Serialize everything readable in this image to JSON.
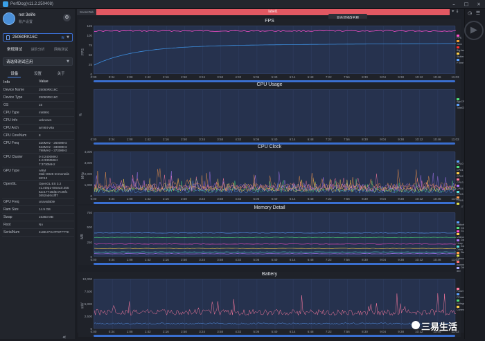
{
  "window": {
    "title": "PerfDog(v11.2.250408)"
  },
  "user": {
    "name": "net 3elife",
    "sub": "账户设置"
  },
  "device": {
    "name": "25060RK16C"
  },
  "modes": [
    {
      "label": "常规测试",
      "active": true
    },
    {
      "label": "进阶分析",
      "active": false
    },
    {
      "label": "网络测试",
      "active": false
    }
  ],
  "app_select": {
    "value": "请选择测试应用"
  },
  "sub_tabs": [
    {
      "label": "设备",
      "active": true
    },
    {
      "label": "设置",
      "active": false
    },
    {
      "label": "关于",
      "active": false
    }
  ],
  "info": {
    "header_key": "Info",
    "header_value": "Value",
    "rows": [
      {
        "k": "Device Name",
        "v": "25060RK16C"
      },
      {
        "k": "Device Type",
        "v": "25060RK16C"
      },
      {
        "k": "OS",
        "v": "15"
      },
      {
        "k": "CPU Type",
        "v": "mt6991"
      },
      {
        "k": "CPU Info",
        "v": "unknown"
      },
      {
        "k": "CPU Arch",
        "v": "arm64-v8a"
      },
      {
        "k": "CPU CoreNum",
        "v": "8"
      },
      {
        "k": "CPU Freq",
        "v": "320MHz - 2600MHz\n622MHz - 3300MHz\n798MHz - 3730MHz"
      },
      {
        "k": "CPU Cluster",
        "v": "0-3:2400MHz\n4-6:3300MHz\n7:3730MHz"
      },
      {
        "k": "GPU Type",
        "v": "ARM\nMali-G925-Immortalis\nMC12"
      },
      {
        "k": "OpenGL",
        "v": "OpenGL ES 3.2\nv1.r49p1-00eac0.455\n5ac17718d6c7c25f1\n3652ad6cdff7"
      },
      {
        "k": "GPU Freq",
        "v": "unavailable"
      },
      {
        "k": "Ram Size",
        "v": "14.9 GB"
      },
      {
        "k": "Swap",
        "v": "16383 MB"
      },
      {
        "k": "Root",
        "v": "No"
      },
      {
        "k": "SerialNum",
        "v": "4LBEJ7X47P877TTK"
      }
    ]
  },
  "topbar": {
    "tab": "SceneTab",
    "label": "label1",
    "tooltip": "双击可修改名称"
  },
  "log_label": "Log",
  "watermark": "三易生活",
  "x_ticks": [
    "0:00",
    "0:34",
    "1:08",
    "1:42",
    "2:16",
    "2:50",
    "3:24",
    "3:58",
    "4:32",
    "5:06",
    "5:40",
    "6:14",
    "6:48",
    "7:22",
    "7:56",
    "8:30",
    "9:04",
    "9:38",
    "10:12",
    "10:46",
    "11:03"
  ],
  "panels": [
    {
      "title": "FPS",
      "unit": "FPS",
      "yticks": [
        "125",
        "100",
        "75",
        "50",
        "25",
        "0"
      ],
      "legend": "",
      "right_legend": [
        {
          "label": "FPS",
          "color": "#ff4fcf"
        },
        {
          "label": "Jank",
          "color": "#f0a030"
        },
        {
          "label": "BigJank",
          "color": "#ff3030"
        },
        {
          "label": "Stutter",
          "color": "#ffd04a"
        },
        {
          "label": "FTime",
          "color": "#5aa0ff"
        }
      ]
    },
    {
      "title": "CPU Usage",
      "unit": "%",
      "yticks": [],
      "legend": "",
      "right_legend": [
        {
          "label": "AppCPU",
          "color": "#4fe07a"
        },
        {
          "label": "TotalCPU",
          "color": "#5aa0ff"
        }
      ]
    },
    {
      "title": "CPU Clock",
      "unit": "MHz",
      "yticks": [
        "4,000",
        "3,000",
        "2,000",
        "1,000",
        "0"
      ],
      "legend": "",
      "right_legend": [
        {
          "label": "CPU0",
          "color": "#5aa0ff"
        },
        {
          "label": "CPU1",
          "color": "#4fe07a"
        },
        {
          "label": "CPU2",
          "color": "#ffd04a"
        },
        {
          "label": "CPU3",
          "color": "#ff7aa0"
        },
        {
          "label": "CPU4",
          "color": "#b07aff"
        },
        {
          "label": "CPU5",
          "color": "#5ae0e0"
        },
        {
          "label": "CPU6",
          "color": "#ff9a4a"
        },
        {
          "label": "CPU7",
          "color": "#e0e04a"
        }
      ]
    },
    {
      "title": "Memory Detail",
      "unit": "MB",
      "yticks": [
        "750",
        "500",
        "250",
        "0"
      ],
      "legend": "",
      "right_legend": [
        {
          "label": "NativePss",
          "color": "#5aa0ff"
        },
        {
          "label": "Gfx",
          "color": "#4fe07a"
        },
        {
          "label": "GL",
          "color": "#ff4fcf"
        },
        {
          "label": "Unknown",
          "color": "#ffd04a"
        },
        {
          "label": "Dalvik Heap",
          "color": "#b07aff"
        },
        {
          "label": "Dalvik Other",
          "color": "#5ae0e0"
        },
        {
          "label": "Stack",
          "color": "#ff9a4a"
        },
        {
          "label": "Cursor",
          "color": "#e0e04a"
        },
        {
          "label": "Ashmem",
          "color": "#ff7070"
        },
        {
          "label": "Other dev",
          "color": "#aaaaff"
        }
      ]
    },
    {
      "title": "Battery",
      "unit": "mW",
      "yticks": [
        "10,000",
        "7,500",
        "5,000",
        "2,500",
        "0"
      ],
      "legend": "",
      "right_legend": [
        {
          "label": "Power",
          "color": "#ff7aa0"
        },
        {
          "label": "FPower",
          "color": "#5aa0ff"
        },
        {
          "label": "Voltage",
          "color": "#4fe07a"
        },
        {
          "label": "Current",
          "color": "#ffd04a"
        }
      ]
    }
  ],
  "colors": {
    "plot_bg": "#26324e",
    "accent": "#3a6fd0",
    "red_bar": "#e25862"
  }
}
